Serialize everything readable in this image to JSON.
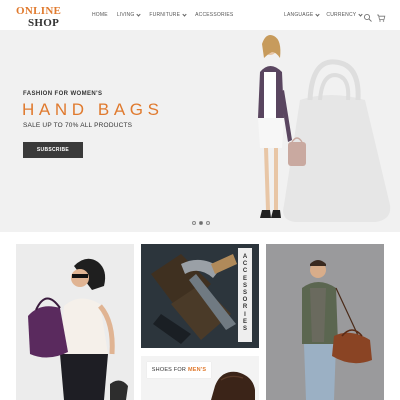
{
  "brand": {
    "line1": "ONLINE",
    "line2": "SHOP"
  },
  "nav": {
    "left": [
      {
        "label": "HOME",
        "dropdown": false
      },
      {
        "label": "LIVING",
        "dropdown": true
      },
      {
        "label": "FURNITURE",
        "dropdown": true
      },
      {
        "label": "ACCESSORIES",
        "dropdown": false
      }
    ],
    "right": [
      {
        "label": "LANGUAGE",
        "dropdown": true
      },
      {
        "label": "CURRENCY",
        "dropdown": true
      }
    ],
    "icons": {
      "search": "search-icon",
      "cart": "cart-icon"
    }
  },
  "hero": {
    "kicker": "FASHION FOR WOMEN'S",
    "title": "HAND BAGS",
    "subtitle": "SALE UP TO 70% ALL PRODUCTS",
    "button": "SUBSCRIBE",
    "slide_count": 3,
    "active_slide": 2
  },
  "tiles": {
    "accessories_label": "ACCESSORIES",
    "shoes_label_a": "SHOES FOR",
    "shoes_label_b": "MEN'S"
  },
  "colors": {
    "accent": "#e07a2e",
    "dark": "#3a3a3a",
    "hero_bg": "#f1f1f1"
  }
}
